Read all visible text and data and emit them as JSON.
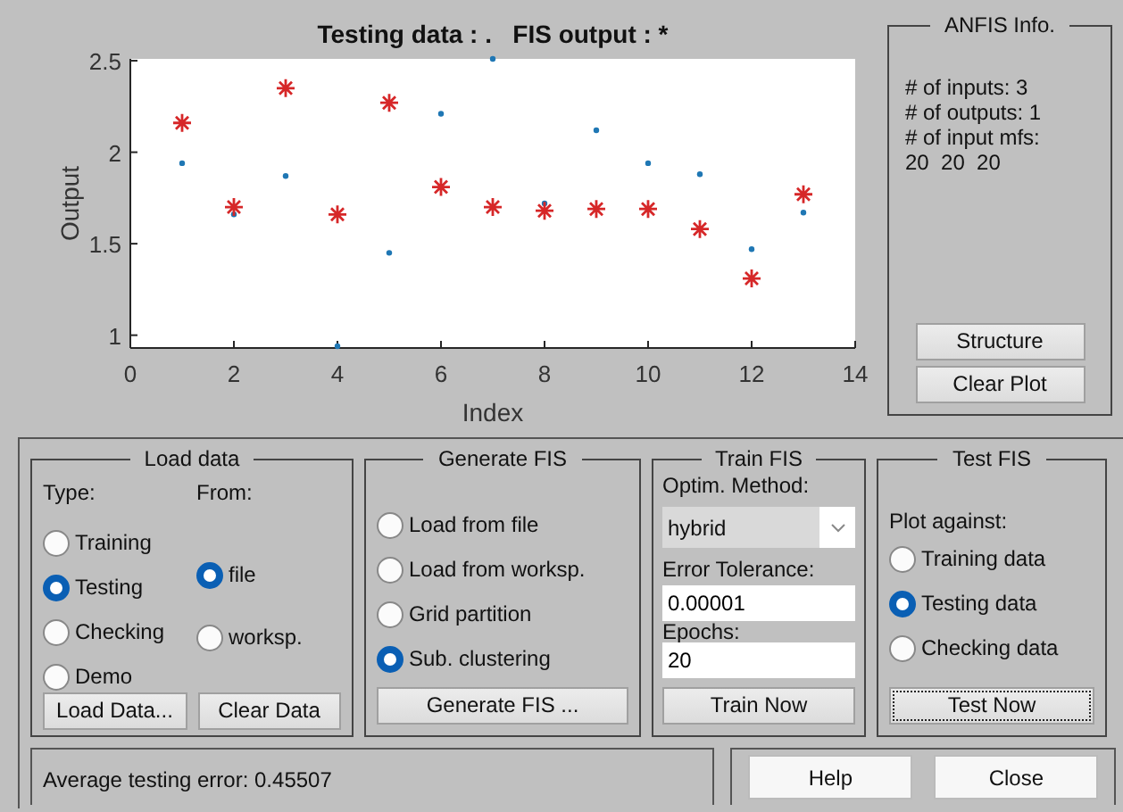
{
  "plot": {
    "title": "Testing data : .   FIS output : *",
    "chart_data": {
      "type": "scatter",
      "xlabel": "Index",
      "ylabel": "Output",
      "x": [
        1,
        2,
        3,
        4,
        5,
        6,
        7,
        8,
        9,
        10,
        11,
        12,
        13
      ],
      "series": [
        {
          "color": "#1f77b4",
          "values": [
            1.94,
            1.66,
            1.87,
            0.94,
            1.45,
            2.21,
            2.51,
            1.72,
            2.12,
            1.94,
            1.88,
            1.47,
            1.67
          ]
        },
        {
          "color": "#d62728",
          "values": [
            2.16,
            1.7,
            2.35,
            1.66,
            2.27,
            1.81,
            1.7,
            1.68,
            1.69,
            1.69,
            1.58,
            1.31,
            1.77
          ]
        }
      ],
      "xlim": [
        0,
        14
      ],
      "ylim": [
        0.93,
        2.51
      ],
      "xticks": [
        0,
        2,
        4,
        6,
        8,
        10,
        12,
        14
      ],
      "yticks": [
        1,
        1.5,
        2,
        2.5
      ]
    }
  },
  "anfis_info": {
    "title": "ANFIS Info.",
    "lines": [
      "# of inputs: 3",
      "# of outputs: 1",
      "# of input mfs:",
      "20  20  20"
    ],
    "buttons": [
      "Structure",
      "Clear Plot"
    ]
  },
  "load_data": {
    "title": "Load data",
    "type_label": "Type:",
    "from_label": "From:",
    "type_options": [
      {
        "label": "Training",
        "selected": false
      },
      {
        "label": "Testing",
        "selected": true
      },
      {
        "label": "Checking",
        "selected": false
      },
      {
        "label": "Demo",
        "selected": false
      }
    ],
    "from_options": [
      {
        "label": "file",
        "selected": true
      },
      {
        "label": "worksp.",
        "selected": false
      }
    ],
    "buttons": [
      "Load Data...",
      "Clear Data"
    ]
  },
  "generate_fis": {
    "title": "Generate FIS",
    "options": [
      {
        "label": "Load from file",
        "selected": false
      },
      {
        "label": "Load from worksp.",
        "selected": false
      },
      {
        "label": "Grid partition",
        "selected": false
      },
      {
        "label": "Sub. clustering",
        "selected": true
      }
    ],
    "button": "Generate FIS ..."
  },
  "train_fis": {
    "title": "Train FIS",
    "method_label": "Optim. Method:",
    "method": "hybrid",
    "tolerance_label": "Error Tolerance:",
    "tolerance": "0.00001",
    "epochs_label": "Epochs:",
    "epochs": "20",
    "button": "Train Now"
  },
  "test_fis": {
    "title": "Test FIS",
    "plot_against_label": "Plot against:",
    "options": [
      {
        "label": "Training data",
        "selected": false
      },
      {
        "label": "Testing data",
        "selected": true
      },
      {
        "label": "Checking data",
        "selected": false
      }
    ],
    "button": {
      "label": "Test Now",
      "focused": true
    }
  },
  "status": "Average testing error: 0.45507",
  "buttons": [
    "Help",
    "Close"
  ]
}
